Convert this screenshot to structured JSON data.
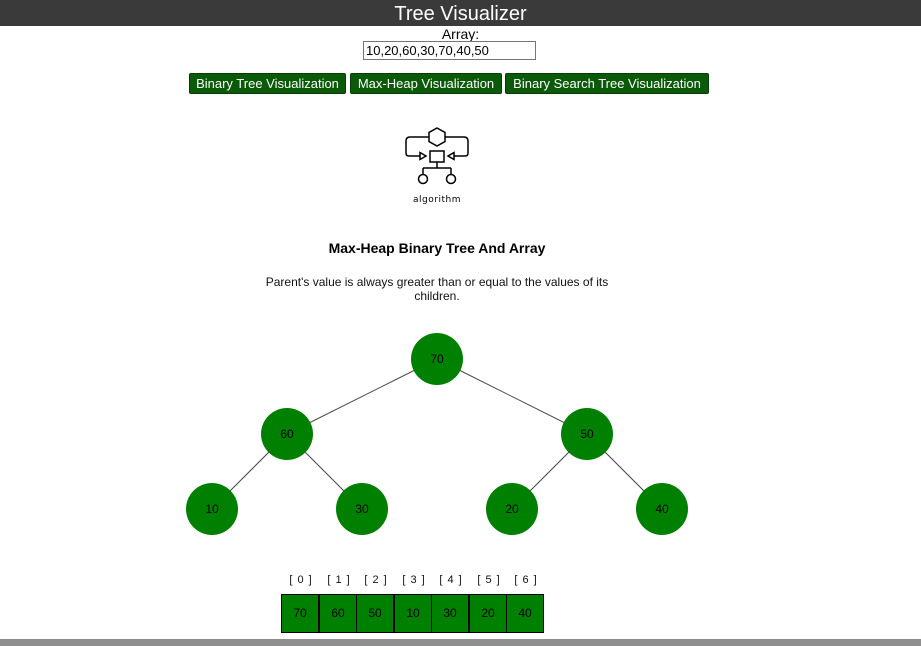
{
  "header": {
    "title": "Tree Visualizer"
  },
  "input": {
    "label": "Array:",
    "value": "10,20,60,30,70,40,50"
  },
  "buttons": [
    {
      "label": "Binary Tree Visualization"
    },
    {
      "label": "Max-Heap Visualization"
    },
    {
      "label": "Binary Search Tree Visualization"
    }
  ],
  "logo": {
    "caption": "algorithm"
  },
  "section": {
    "heading": "Max-Heap Binary Tree And Array",
    "description": "Parent's value is always greater than or equal to the values of its children."
  },
  "tree": {
    "nodes": [
      "70",
      "60",
      "50",
      "10",
      "30",
      "20",
      "40"
    ]
  },
  "array": {
    "indices": [
      "[ 0 ]",
      "[ 1 ]",
      "[ 2 ]",
      "[ 3 ]",
      "[ 4 ]",
      "[ 5 ]",
      "[ 6 ]"
    ],
    "values": [
      "70",
      "60",
      "50",
      "10",
      "30",
      "20",
      "40"
    ]
  },
  "colors": {
    "node": "#008000",
    "button": "#0a5a0a",
    "header": "#3a3a3a"
  }
}
